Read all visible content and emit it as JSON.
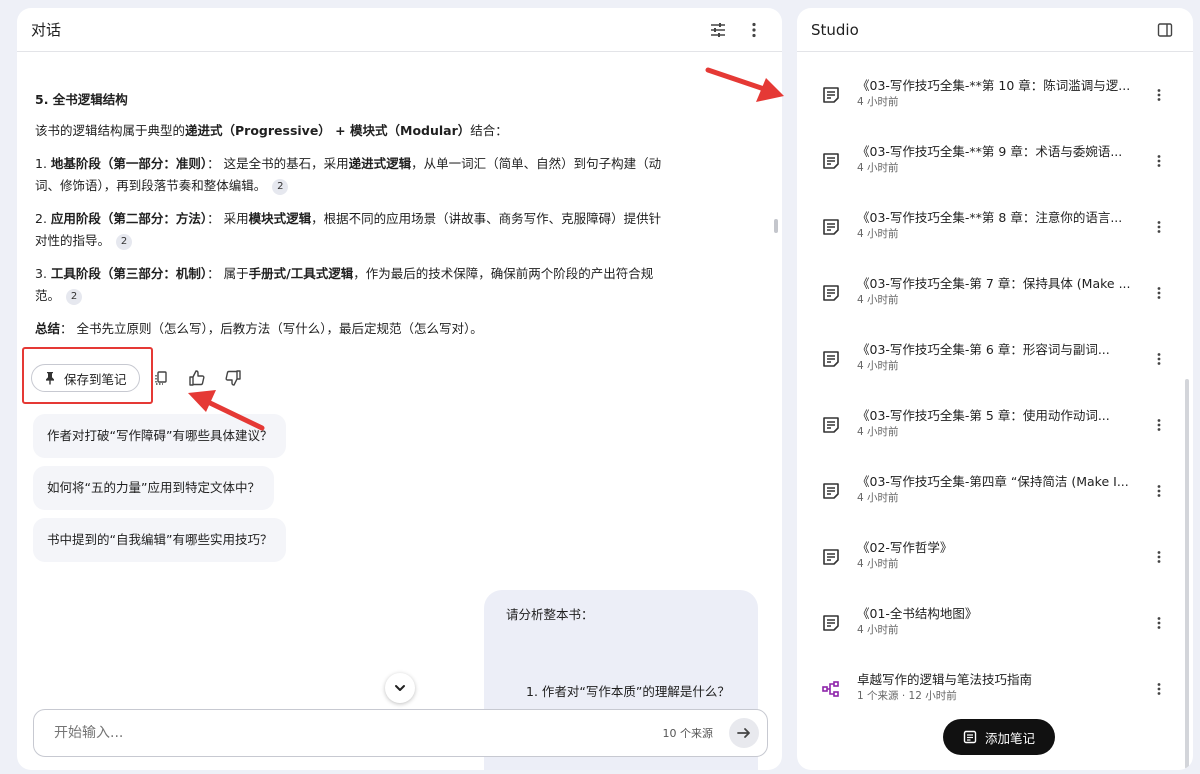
{
  "chat": {
    "title": "对话",
    "section_title": "5. 全书逻辑结构",
    "intro_pre": "该书的逻辑结构属于典型的",
    "intro_b1": "递进式（Progressive）",
    "intro_plus": " + ",
    "intro_b2": "模块式（Modular）",
    "intro_post": "结合：",
    "items": [
      {
        "num": "1. ",
        "bold": "地基阶段（第一部分：准则）",
        "pre": "： 这是全书的基石，采用",
        "bold2": "递进式逻辑",
        "post": "，从单一词汇（简单、自然）到句子构建（动词、修饰语），再到段落节奏和整体编辑。",
        "cite": "2"
      },
      {
        "num": "2. ",
        "bold": "应用阶段（第二部分：方法）",
        "pre": "： 采用",
        "bold2": "模块式逻辑",
        "post": "，根据不同的应用场景（讲故事、商务写作、克服障碍）提供针对性的指导。",
        "cite": "2"
      },
      {
        "num": "3. ",
        "bold": "工具阶段（第三部分：机制）",
        "pre": "： 属于",
        "bold2": "手册式/工具式逻辑",
        "post": "，作为最后的技术保障，确保前两个阶段的产出符合规范。",
        "cite": "2"
      }
    ],
    "summary_bold": "总结",
    "summary_text": "： 全书先立原则（怎么写），后教方法（写什么），最后定规范（怎么写对）。",
    "save_label": "保存到笔记",
    "suggestions": [
      "作者对打破“写作障碍”有哪些具体建议？",
      "如何将“五的力量”应用到特定文体中？",
      "书中提到的“自我编辑”有哪些实用技巧？"
    ],
    "user_message_line1": "请分析整本书：",
    "user_message_line2": "1. 作者对“写作本质”的理解是什么？",
    "input_placeholder": "开始输入...",
    "source_count": "10 个来源"
  },
  "studio": {
    "title": "Studio",
    "notes": [
      {
        "title": "《03-写作技巧全集-**第 10 章：陈词滥调与逻...",
        "time": "4 小时前",
        "icon": "note-icon"
      },
      {
        "title": "《03-写作技巧全集-**第 9 章：术语与委婉语...",
        "time": "4 小时前",
        "icon": "note-icon"
      },
      {
        "title": "《03-写作技巧全集-**第 8 章：注意你的语言...",
        "time": "4 小时前",
        "icon": "note-icon"
      },
      {
        "title": "《03-写作技巧全集-第 7 章：保持具体 (Make ...",
        "time": "4 小时前",
        "icon": "note-icon"
      },
      {
        "title": "《03-写作技巧全集-第 6 章：形容词与副词...",
        "time": "4 小时前",
        "icon": "note-icon"
      },
      {
        "title": "《03-写作技巧全集-第 5 章：使用动作动词...",
        "time": "4 小时前",
        "icon": "note-icon"
      },
      {
        "title": "《03-写作技巧全集-第四章 “保持简洁 (Make I...",
        "time": "4 小时前",
        "icon": "note-icon"
      },
      {
        "title": "《02-写作哲学》",
        "time": "4 小时前",
        "icon": "note-icon"
      },
      {
        "title": "《01-全书结构地图》",
        "time": "4 小时前",
        "icon": "note-icon"
      },
      {
        "title": "卓越写作的逻辑与笔法技巧指南",
        "time": "1 个来源 · 12 小时前",
        "icon": "mindmap-icon"
      }
    ],
    "add_note_label": "添加笔记"
  },
  "colors": {
    "accent_red": "#e53935",
    "mindmap_purple": "#8e24aa",
    "panel_bg": "#ffffff",
    "page_bg": "#eef0f7"
  }
}
